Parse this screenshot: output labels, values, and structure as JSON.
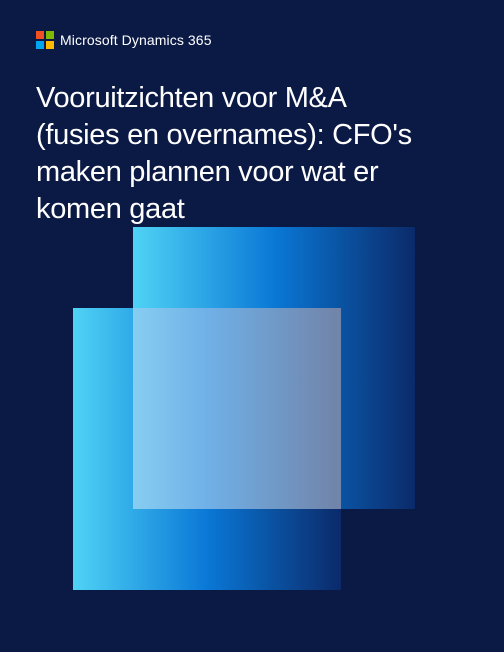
{
  "brand": {
    "name": "Microsoft Dynamics 365",
    "logo_colors": [
      "#f25022",
      "#7fba00",
      "#00a4ef",
      "#ffb900"
    ]
  },
  "title": {
    "lines": [
      "Vooruitzichten voor M&A",
      "(fusies en overnames): CFO's",
      "maken plannen voor wat er",
      "komen gaat"
    ]
  },
  "colors": {
    "background": "#0b1a45",
    "gradient_light": "#4fd3f5",
    "gradient_mid": "#0a78d6",
    "gradient_dark": "#0b2a6a"
  }
}
